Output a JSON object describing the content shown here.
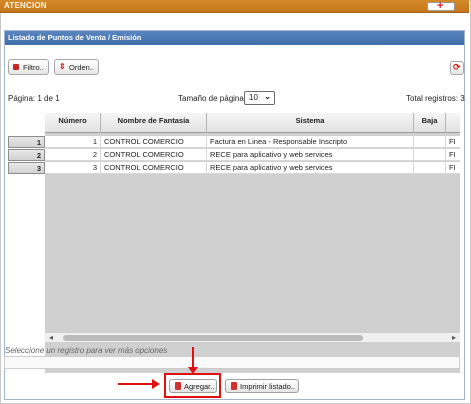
{
  "header": {
    "title": "ATENCION",
    "add_symbol": "+"
  },
  "panel": {
    "title": "Listado de Puntos de Venta / Emisión"
  },
  "toolbar": {
    "filter_label": "Filtro..",
    "order_label": "Orden..",
    "order_symbol": "⇕",
    "refresh_symbol": "⟳"
  },
  "pager": {
    "page_info": "Página: 1 de 1",
    "page_size_label": "Tamaño de página:",
    "page_size_value": "10",
    "total": "Total registros: 3"
  },
  "table": {
    "columns": [
      "Número",
      "Nombre de Fantasía",
      "Sistema",
      "Baja"
    ],
    "rows": [
      {
        "index": "1",
        "numero": "1",
        "nombre": "CONTROL COMERCIO",
        "sistema": "Factura en Linea - Responsable Inscripto",
        "baja": "",
        "extra": "FI"
      },
      {
        "index": "2",
        "numero": "2",
        "nombre": "CONTROL COMERCIO",
        "sistema": "RECE para aplicativo y web services",
        "baja": "",
        "extra": "FI"
      },
      {
        "index": "3",
        "numero": "3",
        "nombre": "CONTROL COMERCIO",
        "sistema": "RECE para aplicativo y web services",
        "baja": "",
        "extra": "FI"
      }
    ]
  },
  "hint": "Seleccione un registro para ver más opciones",
  "actions": {
    "add_label": "Agregar..",
    "print_label": "Imprimir listado.."
  },
  "colors": {
    "header_orange": "#c4761a",
    "panel_blue": "#3f6ea9",
    "highlight_red": "#e01010"
  }
}
